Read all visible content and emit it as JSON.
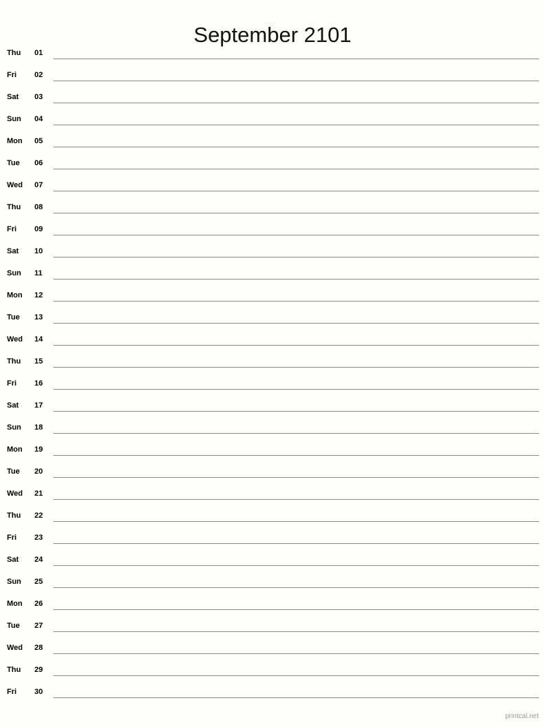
{
  "document": {
    "title": "September 2101",
    "month_name": "September",
    "year": "2101",
    "layout": "notes-list",
    "background_color": "#fdfdfa",
    "line_color": "#8a8a8a",
    "text_color": "#000000"
  },
  "footer": {
    "watermark": "printcal.net",
    "watermark_color": "#9a9a9a"
  },
  "days": [
    {
      "weekday": "Thu",
      "number": "01"
    },
    {
      "weekday": "Fri",
      "number": "02"
    },
    {
      "weekday": "Sat",
      "number": "03"
    },
    {
      "weekday": "Sun",
      "number": "04"
    },
    {
      "weekday": "Mon",
      "number": "05"
    },
    {
      "weekday": "Tue",
      "number": "06"
    },
    {
      "weekday": "Wed",
      "number": "07"
    },
    {
      "weekday": "Thu",
      "number": "08"
    },
    {
      "weekday": "Fri",
      "number": "09"
    },
    {
      "weekday": "Sat",
      "number": "10"
    },
    {
      "weekday": "Sun",
      "number": "11"
    },
    {
      "weekday": "Mon",
      "number": "12"
    },
    {
      "weekday": "Tue",
      "number": "13"
    },
    {
      "weekday": "Wed",
      "number": "14"
    },
    {
      "weekday": "Thu",
      "number": "15"
    },
    {
      "weekday": "Fri",
      "number": "16"
    },
    {
      "weekday": "Sat",
      "number": "17"
    },
    {
      "weekday": "Sun",
      "number": "18"
    },
    {
      "weekday": "Mon",
      "number": "19"
    },
    {
      "weekday": "Tue",
      "number": "20"
    },
    {
      "weekday": "Wed",
      "number": "21"
    },
    {
      "weekday": "Thu",
      "number": "22"
    },
    {
      "weekday": "Fri",
      "number": "23"
    },
    {
      "weekday": "Sat",
      "number": "24"
    },
    {
      "weekday": "Sun",
      "number": "25"
    },
    {
      "weekday": "Mon",
      "number": "26"
    },
    {
      "weekday": "Tue",
      "number": "27"
    },
    {
      "weekday": "Wed",
      "number": "28"
    },
    {
      "weekday": "Thu",
      "number": "29"
    },
    {
      "weekday": "Fri",
      "number": "30"
    }
  ]
}
